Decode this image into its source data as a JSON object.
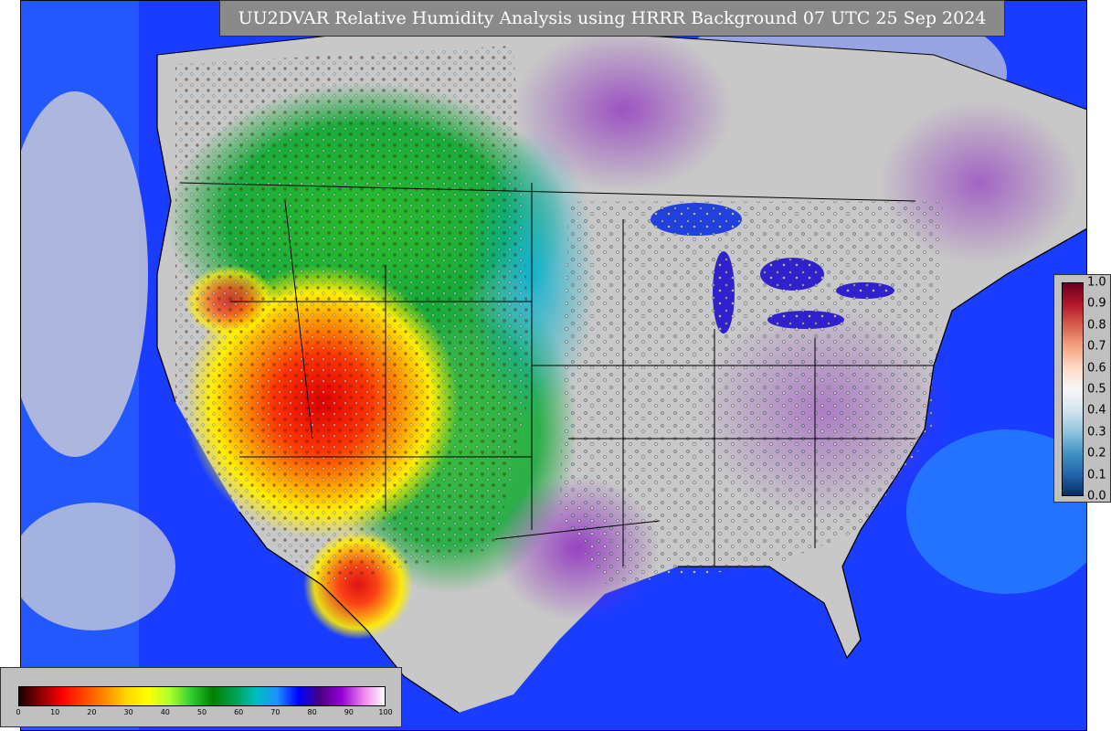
{
  "title": "UU2DVAR Relative Humidity Analysis using HRRR Background 07 UTC 25 Sep 2024",
  "rh_colorbar": {
    "ticks": [
      "0",
      "10",
      "20",
      "30",
      "40",
      "50",
      "60",
      "70",
      "80",
      "90",
      "100"
    ],
    "colors": [
      "#1a0000",
      "#8b0000",
      "#ff0000",
      "#ff4500",
      "#ff8c00",
      "#ffd700",
      "#ffff00",
      "#adff2f",
      "#32cd32",
      "#008000",
      "#00a050",
      "#00bfbf",
      "#1e90ff",
      "#0000ff",
      "#4b0082",
      "#9400d3",
      "#ee82ee",
      "#ffffff"
    ]
  },
  "ratio_colorbar": {
    "ticks": [
      "1.0",
      "0.9",
      "0.8",
      "0.7",
      "0.6",
      "0.5",
      "0.4",
      "0.3",
      "0.2",
      "0.1",
      "0.0"
    ],
    "colors": [
      "#67001f",
      "#b2182b",
      "#d6604d",
      "#f4a582",
      "#fddbc7",
      "#f7f7f7",
      "#d1e5f0",
      "#92c5de",
      "#4393c3",
      "#2166ac",
      "#053061"
    ]
  },
  "map_colors": {
    "ocean": "#1a3cff",
    "dry_core": "#ff1a00",
    "land_default": "#c8c8c8",
    "border": "#000000"
  }
}
